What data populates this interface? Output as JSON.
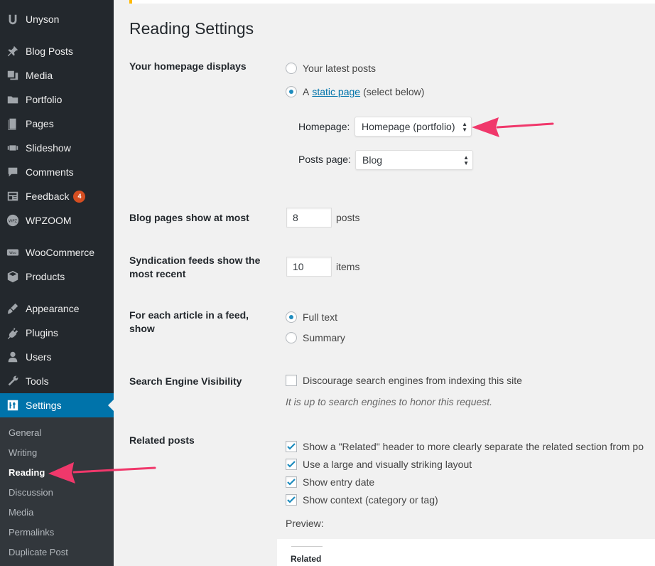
{
  "sidebar": {
    "items": [
      {
        "label": "Unyson",
        "icon": "unyson-icon"
      },
      {
        "label": "Blog Posts",
        "icon": "pin-icon"
      },
      {
        "label": "Media",
        "icon": "media-icon"
      },
      {
        "label": "Portfolio",
        "icon": "folder-icon"
      },
      {
        "label": "Pages",
        "icon": "pages-icon"
      },
      {
        "label": "Slideshow",
        "icon": "slideshow-icon"
      },
      {
        "label": "Comments",
        "icon": "comments-icon"
      },
      {
        "label": "Feedback",
        "icon": "feedback-icon",
        "badge": "4"
      },
      {
        "label": "WPZOOM",
        "icon": "wpzoom-icon"
      },
      {
        "label": "WooCommerce",
        "icon": "woocommerce-icon"
      },
      {
        "label": "Products",
        "icon": "products-icon"
      },
      {
        "label": "Appearance",
        "icon": "brush-icon"
      },
      {
        "label": "Plugins",
        "icon": "plugin-icon"
      },
      {
        "label": "Users",
        "icon": "user-icon"
      },
      {
        "label": "Tools",
        "icon": "wrench-icon"
      },
      {
        "label": "Settings",
        "icon": "settings-icon",
        "active": true
      }
    ],
    "submenu": [
      "General",
      "Writing",
      "Reading",
      "Discussion",
      "Media",
      "Permalinks",
      "Duplicate Post"
    ],
    "current_submenu": "Reading"
  },
  "page": {
    "title": "Reading Settings",
    "homepage_displays": {
      "label": "Your homepage displays",
      "option_latest": "Your latest posts",
      "option_static_prefix": "A",
      "option_static_link": "static page",
      "option_static_suffix": "(select below)",
      "selected": "static",
      "homepage_label": "Homepage:",
      "homepage_value": "Homepage (portfolio)",
      "posts_page_label": "Posts page:",
      "posts_page_value": "Blog"
    },
    "blog_pages": {
      "label": "Blog pages show at most",
      "value": "8",
      "unit": "posts"
    },
    "syndication": {
      "label": "Syndication feeds show the most recent",
      "value": "10",
      "unit": "items"
    },
    "feed_article": {
      "label": "For each article in a feed, show",
      "option_full": "Full text",
      "option_summary": "Summary",
      "selected": "full"
    },
    "search_visibility": {
      "label": "Search Engine Visibility",
      "checkbox_label": "Discourage search engines from indexing this site",
      "checked": false,
      "description": "It is up to search engines to honor this request."
    },
    "related_posts": {
      "label": "Related posts",
      "options": [
        "Show a \"Related\" header to more clearly separate the related section from po",
        "Use a large and visually striking layout",
        "Show entry date",
        "Show context (category or tag)"
      ],
      "preview_label": "Preview:",
      "preview_heading": "Related"
    }
  },
  "colors": {
    "sidebar_bg": "#23282d",
    "submenu_bg": "#32373c",
    "active_bg": "#0073aa",
    "badge_bg": "#d54e21",
    "annotation_arrow": "#f0386b",
    "notice_accent": "#ffb900"
  }
}
